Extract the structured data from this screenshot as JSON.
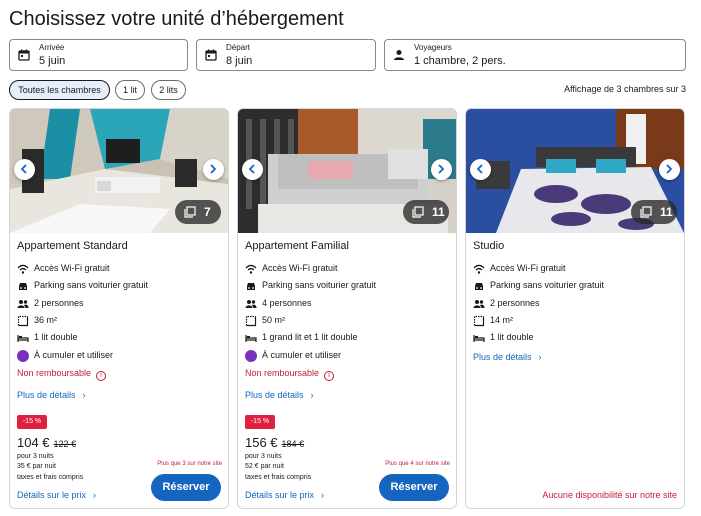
{
  "page": {
    "title": "Choisissez votre unité d’hébergement"
  },
  "search": {
    "arrival": {
      "label": "Arrivée",
      "value": "5 juin",
      "icon": "calendar-icon"
    },
    "departure": {
      "label": "Départ",
      "value": "8 juin",
      "icon": "calendar-icon"
    },
    "guests": {
      "label": "Voyageurs",
      "value": "1 chambre, 2 pers.",
      "icon": "person-icon"
    }
  },
  "filters": {
    "chips": [
      {
        "label": "Toutes les chambres",
        "active": true
      },
      {
        "label": "1 lit",
        "active": false
      },
      {
        "label": "2 lits",
        "active": false
      }
    ],
    "result_count": "Affichage de 3 chambres sur 3"
  },
  "colors": {
    "accent": "#1565c0",
    "alert": "#c41d3a",
    "discount": "#e0203f",
    "promo_icon": "#7b2fbf"
  },
  "rooms": [
    {
      "name": "Appartement Standard",
      "photo_count": "7",
      "amenities": [
        "Accès Wi-Fi gratuit",
        "Parking sans voiturier gratuit",
        "2 personnes",
        "36 m²",
        "1 lit double"
      ],
      "promo": "À cumuler et utiliser",
      "non_refundable": "Non remboursable",
      "info_glyph": "i",
      "details_link": "Plus de détails",
      "discount": "-15 %",
      "price": "104 €",
      "old_price": "122 €",
      "price_detail": [
        "pour 3 nuits",
        "35 € par nuit",
        "taxes et frais compris"
      ],
      "scarcity": "Plus que 3 sur notre site",
      "price_details_link": "Détails sur le prix",
      "reserve_label": "Réserver"
    },
    {
      "name": "Appartement Familial",
      "photo_count": "11",
      "amenities": [
        "Accès Wi-Fi gratuit",
        "Parking sans voiturier gratuit",
        "4 personnes",
        "50 m²",
        "1 grand lit et 1 lit double"
      ],
      "promo": "À cumuler et utiliser",
      "non_refundable": "Non remboursable",
      "info_glyph": "i",
      "details_link": "Plus de détails",
      "discount": "-15 %",
      "price": "156 €",
      "old_price": "184 €",
      "price_detail": [
        "pour 3 nuits",
        "52 € par nuit",
        "taxes et frais compris"
      ],
      "scarcity": "Plus que 4 sur notre site",
      "price_details_link": "Détails sur le prix",
      "reserve_label": "Réserver"
    },
    {
      "name": "Studio",
      "photo_count": "11",
      "amenities": [
        "Accès Wi-Fi gratuit",
        "Parking sans voiturier gratuit",
        "2 personnes",
        "14 m²",
        "1 lit double"
      ],
      "details_link": "Plus de détails",
      "unavailable": "Aucune disponibilité sur notre site"
    }
  ],
  "amenity_icons": [
    "wifi-icon",
    "car-icon",
    "people-icon",
    "area-icon",
    "bed-icon"
  ]
}
